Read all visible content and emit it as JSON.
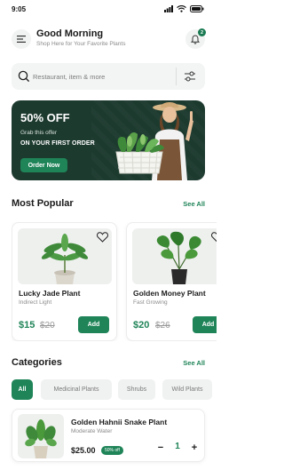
{
  "status_bar": {
    "time": "9:05"
  },
  "header": {
    "greeting": "Good Morning",
    "subtitle": "Shop Here for Your Favorite Plants",
    "notification_count": "2"
  },
  "search": {
    "placeholder": "Restaurant, item & more"
  },
  "banner": {
    "title": "50% OFF",
    "line1": "Grab this offer",
    "line2": "ON YOUR FIRST ORDER",
    "button": "Order Now"
  },
  "most_popular": {
    "title": "Most Popular",
    "see_all": "See All",
    "items": [
      {
        "name": "Lucky Jade Plant",
        "subtitle": "Indirect Light",
        "price": "$15",
        "old_price": "$20",
        "add": "Add"
      },
      {
        "name": "Golden Money Plant",
        "subtitle": "Fast Growing",
        "price": "$20",
        "old_price": "$26",
        "add": "Add"
      }
    ]
  },
  "categories": {
    "title": "Categories",
    "see_all": "See All",
    "chips": [
      "All",
      "Medicinal Plants",
      "Shrubs",
      "Wild Plants"
    ],
    "active_index": 0
  },
  "list_item": {
    "name": "Golden Hahnii Snake Plant",
    "subtitle": "Moderate Water",
    "price": "$25.00",
    "discount": "50% off",
    "minus": "−",
    "quantity": "1",
    "plus": "+"
  },
  "colors": {
    "accent": "#1f8458",
    "banner_bg": "#1d3a2f"
  }
}
